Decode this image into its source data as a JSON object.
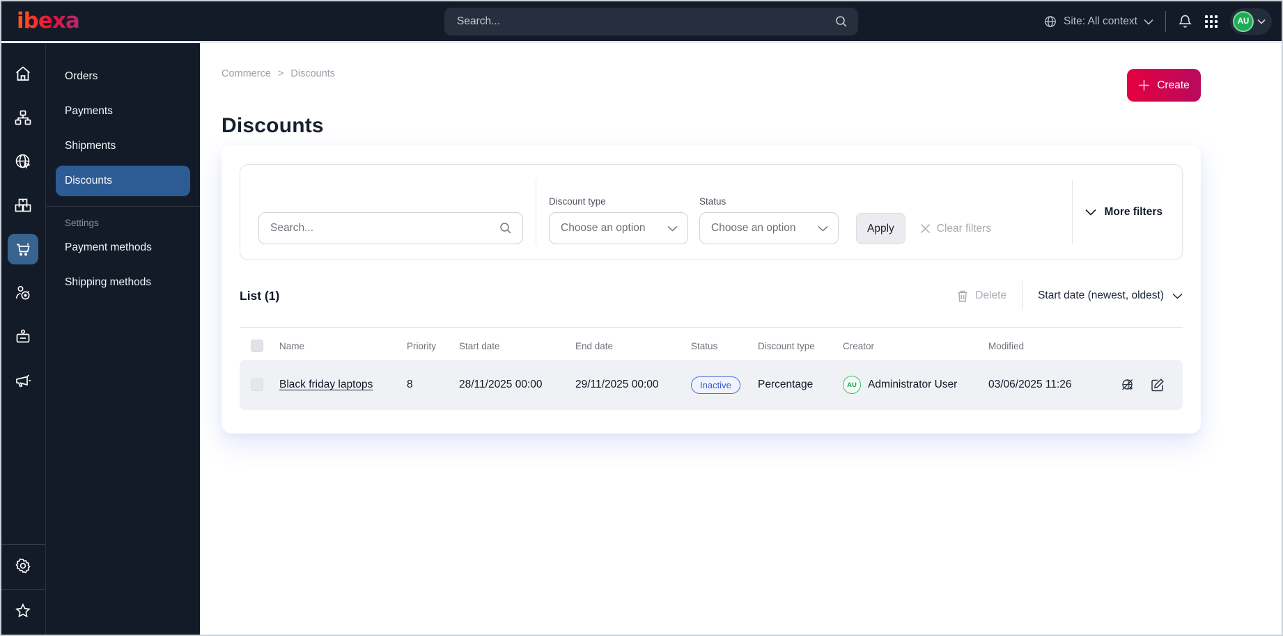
{
  "topbar": {
    "logo_text": "ibexa",
    "search_placeholder": "Search...",
    "site_context": "Site: All context",
    "avatar_initials": "AU"
  },
  "sidebar": {
    "icons": [
      "home-icon",
      "content-tree-icon",
      "site-globe-icon",
      "products-icon",
      "commerce-cart-icon",
      "customers-icon",
      "personnel-icon",
      "marketing-icon"
    ],
    "footer_icons": [
      "settings-icon",
      "favorites-icon"
    ],
    "active_icon": "commerce-cart-icon"
  },
  "submenu": {
    "items": [
      "Orders",
      "Payments",
      "Shipments",
      "Discounts"
    ],
    "active_item": "Discounts",
    "section_label": "Settings",
    "settings_items": [
      "Payment methods",
      "Shipping methods"
    ]
  },
  "breadcrumb": {
    "items": [
      "Commerce",
      "Discounts"
    ],
    "separator": ">"
  },
  "page": {
    "title": "Discounts",
    "create_label": "Create"
  },
  "filters": {
    "search_placeholder": "Search...",
    "discount_type_label": "Discount type",
    "discount_type_value": "Choose an option",
    "status_label": "Status",
    "status_value": "Choose an option",
    "apply_label": "Apply",
    "clear_label": "Clear filters",
    "more_label": "More filters"
  },
  "list": {
    "title": "List (1)",
    "delete_label": "Delete",
    "sort_label": "Start date (newest, oldest)",
    "columns": [
      "Name",
      "Priority",
      "Start date",
      "End date",
      "Status",
      "Discount type",
      "Creator",
      "Modified"
    ],
    "rows": [
      {
        "name": "Black friday laptops",
        "priority": "8",
        "start_date": "28/11/2025 00:00",
        "end_date": "29/11/2025 00:00",
        "status": "Inactive",
        "discount_type": "Percentage",
        "creator_initials": "AU",
        "creator": "Administrator User",
        "modified": "03/06/2025 11:26"
      }
    ]
  },
  "colors": {
    "topbar_bg": "#131b29",
    "active_tile_blue": "#38638e",
    "active_menu_blue": "#2d5c94",
    "brand_gradient_start": "#e50040",
    "brand_gradient_end": "#b80a5e",
    "status_inactive_blue": "#3d5cc8",
    "avatar_green": "#1fab55",
    "row_bg": "#f0f1f4"
  }
}
